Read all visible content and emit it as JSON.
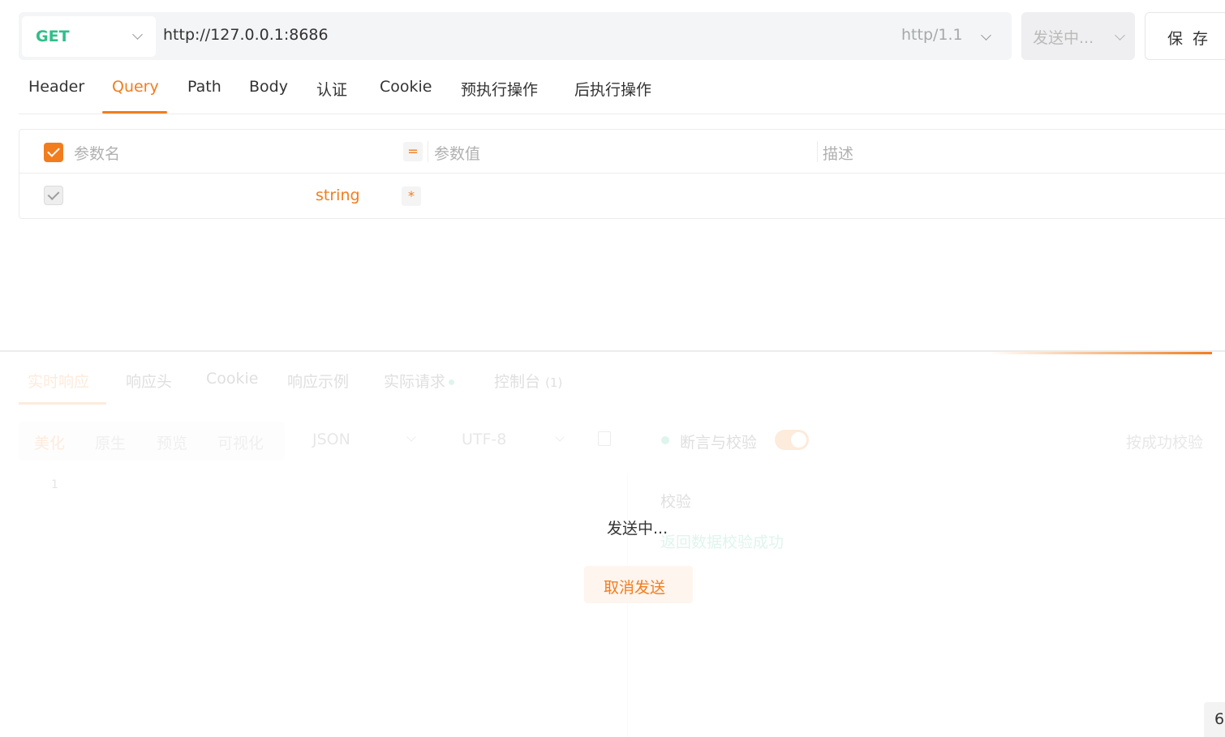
{
  "request": {
    "method": "GET",
    "url": "http://127.0.0.1:8686",
    "http_version": "http/1.1",
    "send_label": "发送中...",
    "save_label": "保 存"
  },
  "request_tabs": [
    {
      "label": "Header",
      "active": false
    },
    {
      "label": "Query",
      "active": true
    },
    {
      "label": "Path",
      "active": false
    },
    {
      "label": "Body",
      "active": false
    },
    {
      "label": "认证",
      "active": false
    },
    {
      "label": "Cookie",
      "active": false
    },
    {
      "label": "预执行操作",
      "active": false
    },
    {
      "label": "后执行操作",
      "active": false
    }
  ],
  "params_table": {
    "headers": {
      "name": "参数名",
      "eq": "=",
      "value": "参数值",
      "description": "描述"
    },
    "rows": [
      {
        "name": "",
        "type": "string",
        "required_mark": "*",
        "value": "",
        "description": ""
      }
    ]
  },
  "response_tabs": [
    {
      "label": "实时响应",
      "active": true
    },
    {
      "label": "响应头",
      "active": false
    },
    {
      "label": "Cookie",
      "active": false
    },
    {
      "label": "响应示例",
      "active": false
    },
    {
      "label": "实际请求",
      "active": false
    },
    {
      "label": "控制台",
      "active": false,
      "badge": "(1)"
    }
  ],
  "response_view": {
    "modes": [
      "美化",
      "原生",
      "预览",
      "可视化"
    ],
    "format": "JSON",
    "encoding": "UTF-8",
    "assert_label": "断言与校验",
    "assert_enabled": true,
    "by_success_label": "按成功校验",
    "line_number": "1",
    "check_title": "校验",
    "check_result": "返回数据校验成功"
  },
  "overlay": {
    "sending_text": "发送中...",
    "cancel_label": "取消发送"
  },
  "corner_widget_glyph": "6",
  "colors": {
    "accent": "#f27d1e",
    "method_get": "#2fbf88",
    "success": "#2fbf88"
  }
}
